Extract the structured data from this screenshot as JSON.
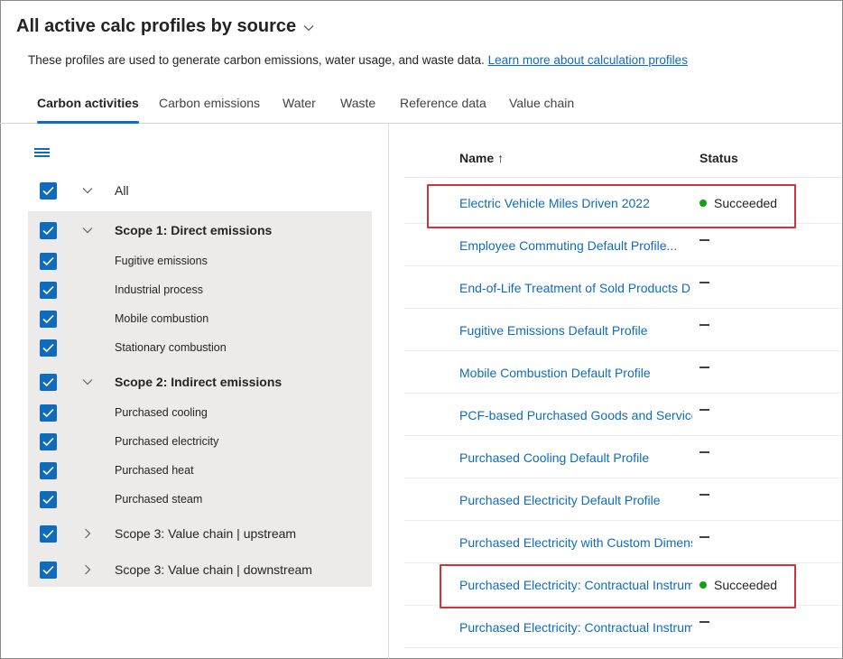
{
  "header": {
    "title": "All active calc profiles by source",
    "description": "These profiles are used to generate carbon emissions, water usage, and waste data.",
    "learn_more_link": "Learn more about calculation profiles"
  },
  "tabs": [
    {
      "label": "Carbon activities",
      "active": true
    },
    {
      "label": "Carbon emissions",
      "active": false
    },
    {
      "label": "Water",
      "active": false
    },
    {
      "label": "Waste",
      "active": false
    },
    {
      "label": "Reference data",
      "active": false
    },
    {
      "label": "Value chain",
      "active": false
    }
  ],
  "tree": {
    "all_label": "All",
    "scope1": {
      "label": "Scope 1: Direct emissions",
      "children": [
        "Fugitive emissions",
        "Industrial process",
        "Mobile combustion",
        "Stationary combustion"
      ]
    },
    "scope2": {
      "label": "Scope 2: Indirect emissions",
      "children": [
        "Purchased cooling",
        "Purchased electricity",
        "Purchased heat",
        "Purchased steam"
      ]
    },
    "scope3_up": {
      "label": "Scope 3: Value chain | upstream"
    },
    "scope3_down": {
      "label": "Scope 3: Value chain | downstream"
    }
  },
  "table": {
    "columns": {
      "name": "Name",
      "name_sort": "↑",
      "status": "Status"
    },
    "rows": [
      {
        "name": "Electric Vehicle Miles Driven 2022",
        "status": "Succeeded"
      },
      {
        "name": "Employee Commuting Default Profile...",
        "status": ""
      },
      {
        "name": "End-of-Life Treatment of Sold Products D",
        "status": ""
      },
      {
        "name": "Fugitive Emissions Default Profile",
        "status": ""
      },
      {
        "name": "Mobile Combustion Default Profile",
        "status": ""
      },
      {
        "name": "PCF-based Purchased Goods and Services",
        "status": ""
      },
      {
        "name": "Purchased Cooling Default Profile",
        "status": ""
      },
      {
        "name": "Purchased Electricity Default Profile",
        "status": ""
      },
      {
        "name": "Purchased Electricity with Custom Dimens",
        "status": ""
      },
      {
        "name": "Purchased Electricity: Contractual Instrum",
        "status": "Succeeded"
      },
      {
        "name": "Purchased Electricity: Contractual Instrum",
        "status": ""
      }
    ]
  },
  "colors": {
    "accent": "#0f6cbd",
    "success": "#13a10e",
    "highlight": "#d13438",
    "panel_bg": "#edebe9"
  },
  "icons": {
    "title_dropdown": "chevron-down-icon",
    "filter_menu": "hamburger-menu-icon",
    "checkbox": "checkmark-icon",
    "expanded": "chevron-down-icon",
    "collapsed": "chevron-right-icon",
    "status_success": "status-dot-icon",
    "status_empty": "dash-icon"
  }
}
